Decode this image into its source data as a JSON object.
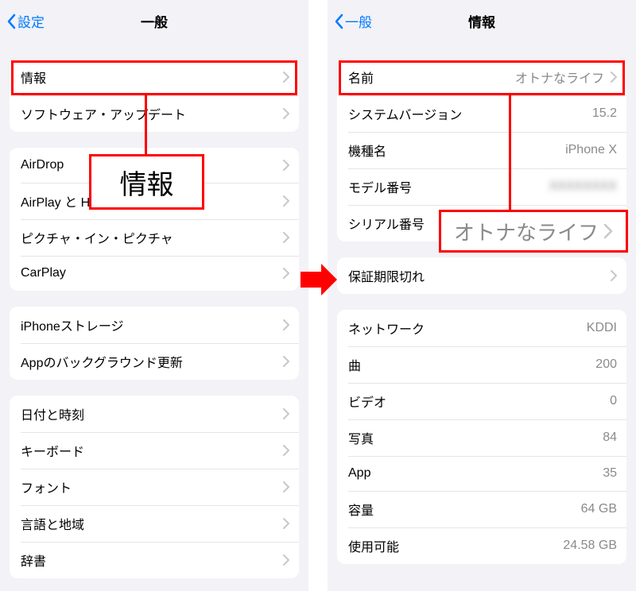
{
  "left": {
    "back": "設定",
    "title": "一般",
    "groups": [
      [
        {
          "label": "情報",
          "disclosure": true
        },
        {
          "label": "ソフトウェア・アップデート",
          "disclosure": true
        }
      ],
      [
        {
          "label": "AirDrop",
          "disclosure": true
        },
        {
          "label": "AirPlay と Handoff",
          "disclosure": true
        },
        {
          "label": "ピクチャ・イン・ピクチャ",
          "disclosure": true
        },
        {
          "label": "CarPlay",
          "disclosure": true
        }
      ],
      [
        {
          "label": "iPhoneストレージ",
          "disclosure": true
        },
        {
          "label": "Appのバックグラウンド更新",
          "disclosure": true
        }
      ],
      [
        {
          "label": "日付と時刻",
          "disclosure": true
        },
        {
          "label": "キーボード",
          "disclosure": true
        },
        {
          "label": "フォント",
          "disclosure": true
        },
        {
          "label": "言語と地域",
          "disclosure": true
        },
        {
          "label": "辞書",
          "disclosure": true
        }
      ]
    ],
    "callout": "情報"
  },
  "right": {
    "back": "一般",
    "title": "情報",
    "groups": [
      [
        {
          "label": "名前",
          "value": "オトナなライフ",
          "disclosure": true
        },
        {
          "label": "システムバージョン",
          "value": "15.2"
        },
        {
          "label": "機種名",
          "value": "iPhone X"
        },
        {
          "label": "モデル番号",
          "value": "",
          "blur": true
        },
        {
          "label": "シリアル番号",
          "value": "",
          "blur": true
        }
      ],
      [
        {
          "label": "保証期限切れ",
          "disclosure": true
        }
      ],
      [
        {
          "label": "ネットワーク",
          "value": "KDDI"
        },
        {
          "label": "曲",
          "value": "200"
        },
        {
          "label": "ビデオ",
          "value": "0"
        },
        {
          "label": "写真",
          "value": "84"
        },
        {
          "label": "App",
          "value": "35"
        },
        {
          "label": "容量",
          "value": "64 GB"
        },
        {
          "label": "使用可能",
          "value": "24.58 GB"
        }
      ]
    ],
    "callout": "オトナなライフ"
  }
}
